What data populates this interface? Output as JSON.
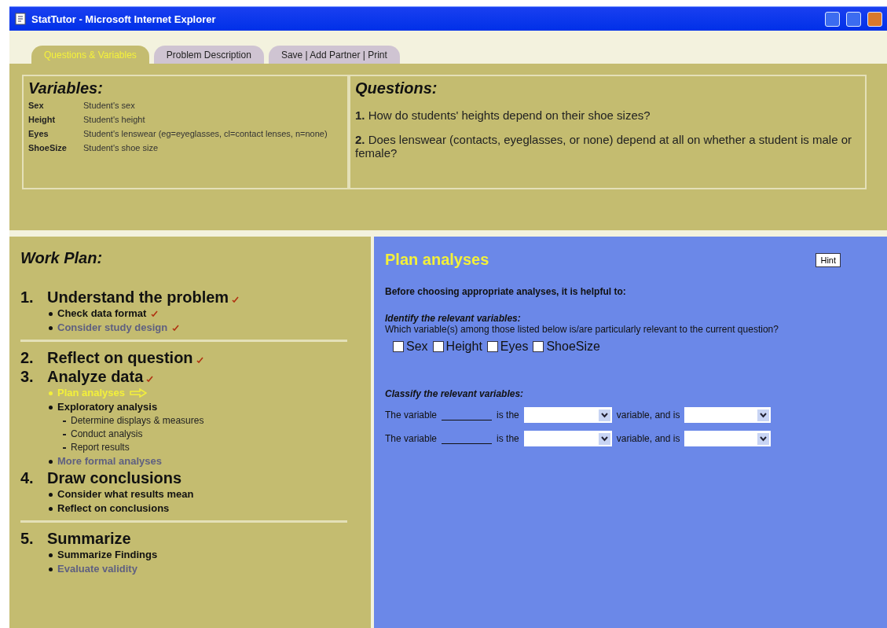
{
  "window": {
    "title": "StatTutor - Microsoft Internet Explorer"
  },
  "tabs": [
    {
      "label": "Questions & Variables",
      "selected": true
    },
    {
      "label": "Problem Description",
      "selected": false
    },
    {
      "label": "Save | Add Partner | Print",
      "selected": false
    }
  ],
  "variables": {
    "title": "Variables:",
    "rows": [
      {
        "name": "Sex",
        "description": "Student's sex"
      },
      {
        "name": "Height",
        "description": "Student's height"
      },
      {
        "name": "Eyes",
        "description": "Student's lenswear (eg=eyeglasses, cl=contact lenses, n=none)"
      },
      {
        "name": "ShoeSize",
        "description": "Student's shoe size"
      }
    ]
  },
  "questions": {
    "title": "Questions:",
    "items": [
      {
        "number": "1.",
        "text": "How do students' heights depend on their shoe sizes?"
      },
      {
        "number": "2.",
        "text": "Does lenswear (contacts, eyeglasses, or none) depend at all on whether a student is male or female?"
      }
    ]
  },
  "work_plan": {
    "title": "Work Plan:",
    "groups": [
      [
        {
          "number": "1.",
          "label": "Understand the problem",
          "checked": true,
          "items": [
            {
              "label": "Check data format",
              "checked": true,
              "current": false,
              "disabled": false
            },
            {
              "label": "Consider study design",
              "checked": true,
              "current": false,
              "disabled": true
            }
          ]
        }
      ],
      [
        {
          "number": "2.",
          "label": "Reflect on question",
          "checked": true
        },
        {
          "number": "3.",
          "label": "Analyze data",
          "checked": true,
          "items": [
            {
              "label": "Plan analyses",
              "checked": false,
              "current": true,
              "disabled": false
            },
            {
              "label": "Exploratory analysis",
              "checked": false,
              "current": false,
              "disabled": false,
              "children": [
                {
                  "label": "Determine displays & measures"
                },
                {
                  "label": "Conduct analysis"
                },
                {
                  "label": "Report results"
                }
              ]
            },
            {
              "label": "More formal analyses",
              "checked": false,
              "current": false,
              "disabled": true
            }
          ]
        },
        {
          "number": "4.",
          "label": "Draw conclusions",
          "checked": false,
          "items": [
            {
              "label": "Consider what results mean",
              "checked": false,
              "current": false,
              "disabled": false
            },
            {
              "label": "Reflect on conclusions",
              "checked": false,
              "current": false,
              "disabled": false
            }
          ]
        }
      ],
      [
        {
          "number": "5.",
          "label": "Summarize",
          "checked": false,
          "items": [
            {
              "label": "Summarize Findings",
              "checked": false,
              "current": false,
              "disabled": false
            },
            {
              "label": "Evaluate validity",
              "checked": false,
              "current": false,
              "disabled": true
            }
          ]
        }
      ]
    ]
  },
  "step": {
    "title": "Plan analyses",
    "hint_button": "Hint",
    "intro": "Before choosing appropriate analyses, it is helpful to:",
    "identify": {
      "heading": "Identify the relevant variables:",
      "prompt": "Which variable(s) among those listed below is/are particularly relevant to the current question?",
      "options": [
        {
          "label": "Sex",
          "checked": false
        },
        {
          "label": "Height",
          "checked": false
        },
        {
          "label": "Eyes",
          "checked": false
        },
        {
          "label": "ShoeSize",
          "checked": false
        }
      ]
    },
    "classify": {
      "heading": "Classify the relevant variables:",
      "rows": [
        {
          "prefix": "The variable",
          "middle": "is the",
          "after": "variable, and is"
        },
        {
          "prefix": "The variable",
          "middle": "is the",
          "after": "variable, and is"
        }
      ]
    }
  }
}
